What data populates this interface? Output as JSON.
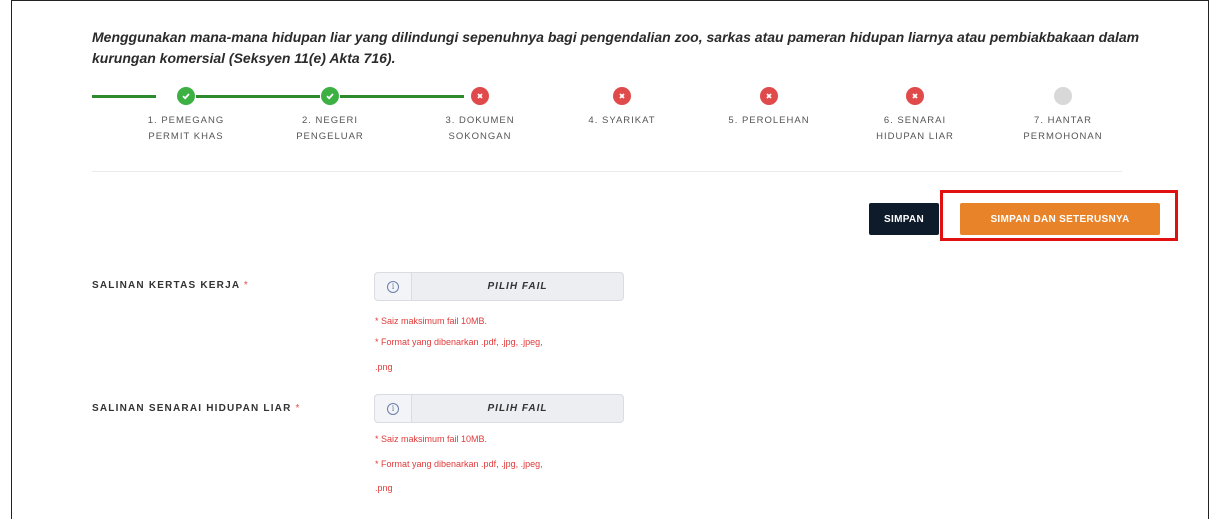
{
  "title": "Menggunakan mana-mana hidupan liar yang dilindungi sepenuhnya bagi pengendalian zoo, sarkas atau pameran hidupan liarnya atau pembiakbakaan dalam kurungan komersial (Seksyen 11(e) Akta 716).",
  "steps": [
    {
      "line1": "1. PEMEGANG",
      "line2": "PERMIT KHAS",
      "status": "done"
    },
    {
      "line1": "2. NEGERI",
      "line2": "PENGELUAR",
      "status": "done"
    },
    {
      "line1": "3. DOKUMEN",
      "line2": "SOKONGAN",
      "status": "error"
    },
    {
      "line1": "4. SYARIKAT",
      "line2": "",
      "status": "error"
    },
    {
      "line1": "5. PEROLEHAN",
      "line2": "",
      "status": "error"
    },
    {
      "line1": "6. SENARAI",
      "line2": "HIDUPAN LIAR",
      "status": "error"
    },
    {
      "line1": "7. HANTAR",
      "line2": "PERMOHONAN",
      "status": "pending"
    }
  ],
  "buttons": {
    "save": "SIMPAN",
    "save_next": "SIMPAN DAN SETERUSNYA"
  },
  "fields": [
    {
      "label": "SALINAN KERTAS KERJA",
      "required_mark": "*",
      "file_button": "PILIH FAIL",
      "info_icon": "info-icon",
      "hint_size": "* Saiz maksimum fail 10MB.",
      "hint_format_1": "* Format yang dibenarkan .pdf, .jpg, .jpeg,",
      "hint_format_2": ".png"
    },
    {
      "label": "SALINAN SENARAI HIDUPAN LIAR",
      "required_mark": "*",
      "file_button": "PILIH FAIL",
      "info_icon": "info-icon",
      "hint_size": "* Saiz maksimum fail 10MB.",
      "hint_format_1": "* Format yang dibenarkan .pdf, .jpg, .jpeg,",
      "hint_format_2": ".png"
    }
  ],
  "colors": {
    "done": "#3cb043",
    "error": "#e04a4a",
    "pending": "#d8d8d8",
    "save_button": "#0d1b2a",
    "save_next_button": "#e8832a",
    "highlight_box": "#e01010",
    "hint_text": "#e03a3a"
  }
}
